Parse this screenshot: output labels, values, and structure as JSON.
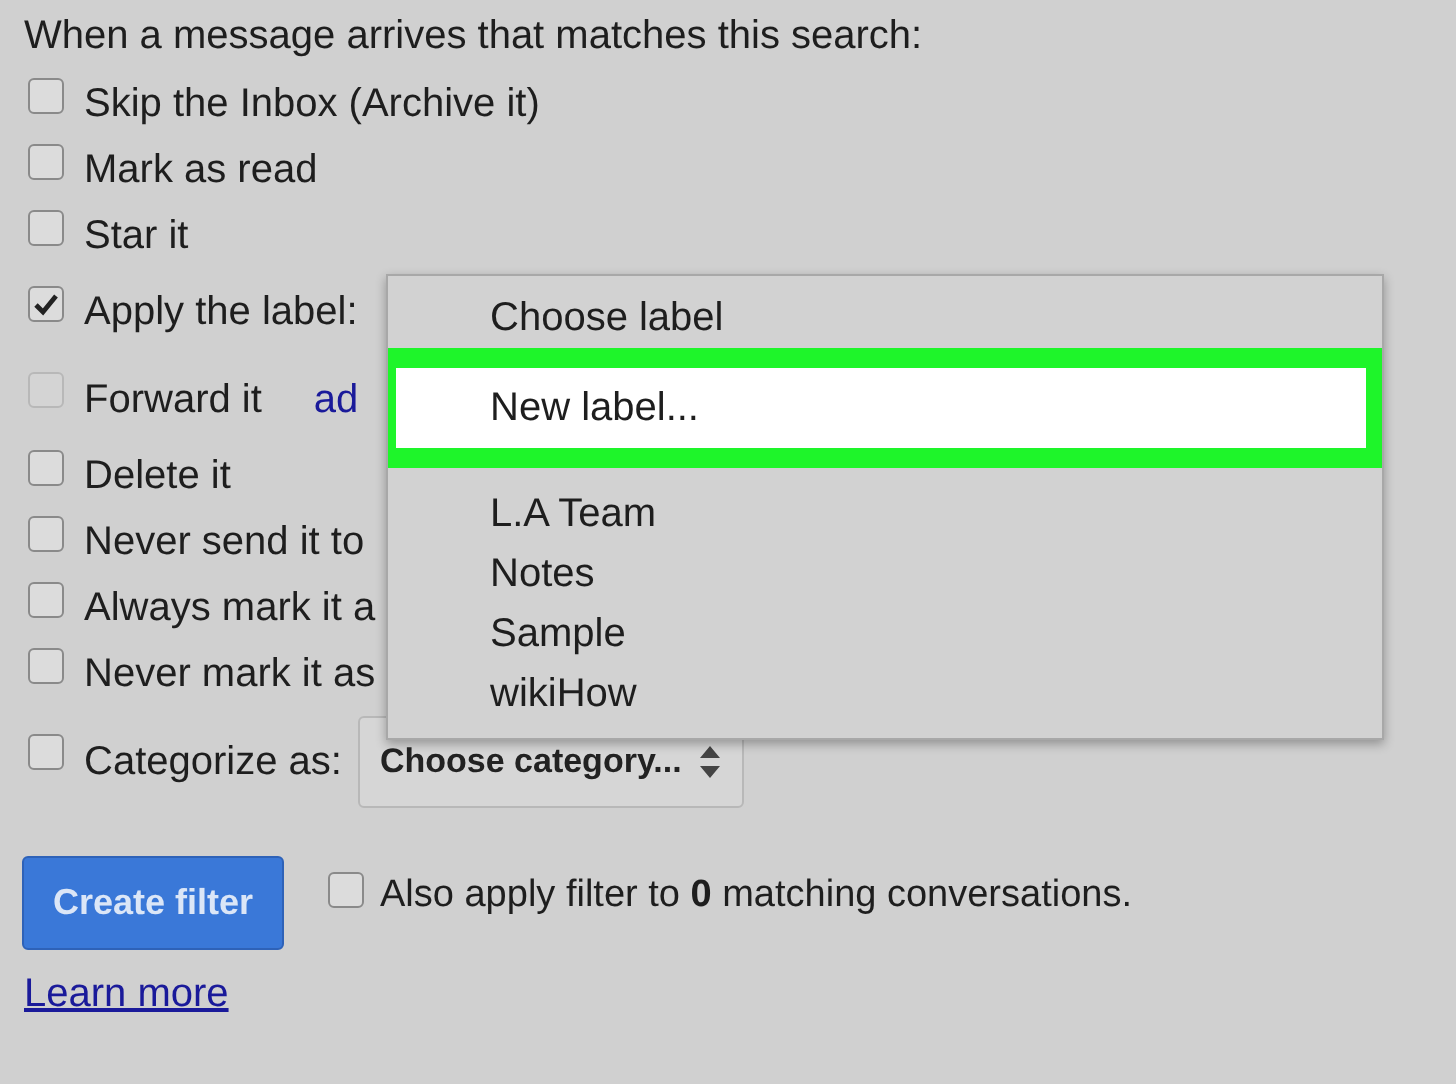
{
  "heading": "When a message arrives that matches this search:",
  "options": [
    {
      "kind": "checkbox",
      "label": "Skip the Inbox (Archive it)",
      "checked": false,
      "disabled": false
    },
    {
      "kind": "checkbox",
      "label": "Mark as read",
      "checked": false,
      "disabled": false
    },
    {
      "kind": "checkbox",
      "label": "Star it",
      "checked": false,
      "disabled": false
    },
    {
      "kind": "label",
      "label": "Apply the label:",
      "checked": true,
      "disabled": false
    },
    {
      "kind": "forward",
      "label": "Forward it",
      "checked": false,
      "disabled": true,
      "link": "ad"
    },
    {
      "kind": "checkbox",
      "label": "Delete it",
      "checked": false,
      "disabled": false
    },
    {
      "kind": "checkbox",
      "label": "Never send it to",
      "checked": false,
      "disabled": false
    },
    {
      "kind": "checkbox",
      "label": "Always mark it a",
      "checked": false,
      "disabled": false
    },
    {
      "kind": "checkbox",
      "label": "Never mark it as",
      "checked": false,
      "disabled": false
    },
    {
      "kind": "category",
      "label": "Categorize as:",
      "checked": false,
      "disabled": false,
      "select": "Choose category..."
    }
  ],
  "label_menu": {
    "groups": [
      [
        {
          "label": "Choose label",
          "selected": false
        },
        {
          "label": "New label...",
          "selected": true
        }
      ],
      [
        {
          "label": "L.A Team",
          "selected": false
        },
        {
          "label": "Notes",
          "selected": false
        },
        {
          "label": "Sample",
          "selected": false
        },
        {
          "label": "wikiHow",
          "selected": false
        }
      ]
    ]
  },
  "create_button": "Create filter",
  "also_apply": {
    "checked": false,
    "text": "Also apply filter to **0** matching conversations."
  },
  "learn_more": "Learn more"
}
